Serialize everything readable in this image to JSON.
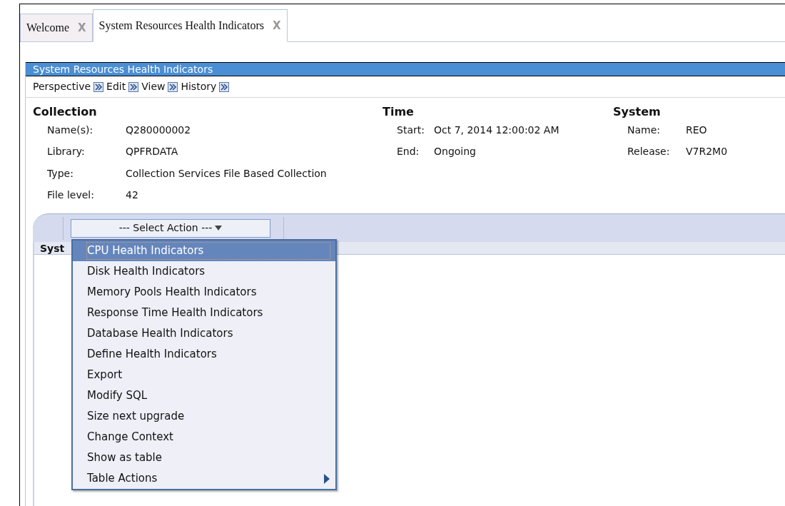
{
  "tabs": [
    {
      "label": "Welcome",
      "selected": false,
      "close": "X"
    },
    {
      "label": "System Resources Health Indicators",
      "selected": true,
      "close": "X"
    }
  ],
  "panel": {
    "title": "System Resources Health Indicators",
    "menus": [
      "Perspective",
      "Edit",
      "View",
      "History"
    ],
    "sections": [
      {
        "heading": "Collection",
        "fields": [
          {
            "label": "Name(s):",
            "value": "Q280000002"
          },
          {
            "label": "Library:",
            "value": "QPFRDATA"
          },
          {
            "label": "Type:",
            "value": "Collection Services File Based Collection"
          },
          {
            "label": "File level:",
            "value": "42"
          }
        ]
      },
      {
        "heading": "Time",
        "fields": [
          {
            "label": "Start:",
            "value": "Oct 7, 2014 12:00:02 AM"
          },
          {
            "label": "End:",
            "value": "Ongoing"
          }
        ]
      },
      {
        "heading": "System",
        "fields": [
          {
            "label": "Name:",
            "value": "REO"
          },
          {
            "label": "Release:",
            "value": "V7R2M0"
          }
        ]
      }
    ],
    "action_select": "--- Select Action ---",
    "column_header": "Syst",
    "action_menu": [
      {
        "label": "CPU Health Indicators",
        "selected": true,
        "kind": "item"
      },
      {
        "label": "Disk Health Indicators",
        "selected": false,
        "kind": "item"
      },
      {
        "label": "Memory Pools Health Indicators",
        "selected": false,
        "kind": "item"
      },
      {
        "label": "Response Time Health Indicators",
        "selected": false,
        "kind": "item"
      },
      {
        "label": "Database Health Indicators",
        "selected": false,
        "kind": "item"
      },
      {
        "label": "Define Health Indicators",
        "selected": false,
        "kind": "item"
      },
      {
        "label": "Export",
        "selected": false,
        "kind": "item"
      },
      {
        "label": "Modify SQL",
        "selected": false,
        "kind": "item"
      },
      {
        "label": "Size next upgrade",
        "selected": false,
        "kind": "item"
      },
      {
        "label": "Change Context",
        "selected": false,
        "kind": "item"
      },
      {
        "label": "Show as table",
        "selected": false,
        "kind": "item"
      },
      {
        "label": "Table Actions",
        "selected": false,
        "kind": "submenu"
      }
    ]
  }
}
